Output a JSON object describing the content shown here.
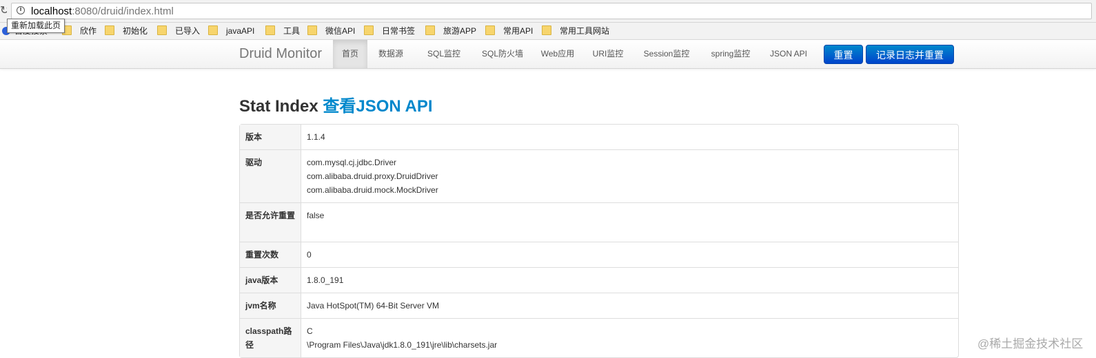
{
  "browser": {
    "url_host": "localhost",
    "url_rest": ":8080/druid/index.html",
    "tooltip": "重新加载此页"
  },
  "bookmarks": [
    "百度搜索",
    "欣作",
    "初始化",
    "已导入",
    "javaAPI",
    "工具",
    "微信API",
    "日常书签",
    "旅游APP",
    "常用API",
    "常用工具网站"
  ],
  "navbar": {
    "brand": "Druid Monitor",
    "links": [
      "首页",
      "数据源",
      "SQL监控",
      "SQL防火墙",
      "Web应用",
      "URI监控",
      "Session监控",
      "spring监控",
      "JSON API"
    ],
    "reset_button": "重置",
    "log_reset_button": "记录日志并重置"
  },
  "page": {
    "title": "Stat Index",
    "title_link": "查看JSON API"
  },
  "stats": {
    "version_key": "版本",
    "version_val": "1.1.4",
    "driver_key": "驱动",
    "drivers": [
      "com.mysql.cj.jdbc.Driver",
      "com.alibaba.druid.proxy.DruidDriver",
      "com.alibaba.druid.mock.MockDriver"
    ],
    "reset_enable_key": "是否允许重置",
    "reset_enable_val": "false",
    "reset_count_key": "重置次数",
    "reset_count_val": "0",
    "java_version_key": "java版本",
    "java_version_val": "1.8.0_191",
    "jvm_name_key": "jvm名称",
    "jvm_name_val": "Java HotSpot(TM) 64-Bit Server VM",
    "classpath_key": "classpath路径",
    "classpath_lines": [
      "C",
      "\\Program Files\\Java\\jdk1.8.0_191\\jre\\lib\\charsets.jar"
    ]
  },
  "watermark": "@稀土掘金技术社区"
}
